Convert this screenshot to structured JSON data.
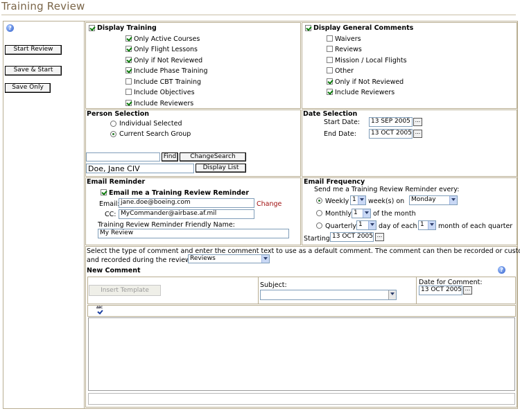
{
  "page": {
    "title": "Training Review"
  },
  "left": {
    "start_review": "Start Review",
    "save_start": "Save & Start",
    "save_only": "Save Only"
  },
  "display_training": {
    "label": "Display Training",
    "items": [
      {
        "label": "Only Active Courses",
        "checked": true
      },
      {
        "label": "Only Flight Lessons",
        "checked": true
      },
      {
        "label": "Only if Not Reviewed",
        "checked": true
      },
      {
        "label": "Include Phase Training",
        "checked": true
      },
      {
        "label": "Include CBT Training",
        "checked": false
      },
      {
        "label": "Include Objectives",
        "checked": false
      },
      {
        "label": "Include Reviewers",
        "checked": true
      }
    ]
  },
  "display_comments": {
    "label": "Display General Comments",
    "items": [
      {
        "label": "Waivers",
        "checked": false
      },
      {
        "label": "Reviews",
        "checked": false
      },
      {
        "label": "Mission / Local Flights",
        "checked": false
      },
      {
        "label": "Other",
        "checked": false
      },
      {
        "label": "Only if Not Reviewed",
        "checked": true
      },
      {
        "label": "Include Reviewers",
        "checked": true
      }
    ]
  },
  "person": {
    "title": "Person Selection",
    "individual": "Individual Selected",
    "current_group": "Current Search Group",
    "find": "Find",
    "change_search": "ChangeSearch",
    "selected_name": "Doe, Jane CIV",
    "display_list": "Display List"
  },
  "date_selection": {
    "title": "Date Selection",
    "start_label": "Start Date:",
    "start_value": "13 SEP 2005",
    "end_label": "End Date:",
    "end_value": "13 OCT 2005"
  },
  "email_reminder": {
    "title": "Email Reminder",
    "checkbox_label": "Email me a Training Review Reminder",
    "email_label": "Email:",
    "email_value": "jane.doe@boeing.com",
    "change": "Change",
    "cc_label": "CC:",
    "cc_value": "MyCommander@airbase.af.mil",
    "friendly_label": "Training Review Reminder Friendly Name:",
    "friendly_value": "My Review"
  },
  "email_frequency": {
    "title": "Email Frequency",
    "intro": "Send me a Training Review Reminder every:",
    "weekly": "Weekly",
    "weekly_count": "1",
    "weeks_on": "week(s) on",
    "weekday": "Monday",
    "monthly": "Monthly",
    "monthly_count": "1",
    "of_month": "of the month",
    "quarterly": "Quarterly",
    "quarterly_day": "1",
    "day_of_each": "day of each",
    "quarter_month": "1",
    "month_of_quarter": "month of each quarter",
    "starting_label": "Starting",
    "starting_value": "13 OCT 2005"
  },
  "comment": {
    "instructions_1": "Select the type of comment and enter the comment text to use as a default comment. The comment can then be recorded or customized",
    "instructions_2": "and recorded during the review.",
    "type_value": "Reviews",
    "new_comment": "New Comment",
    "insert_template": "Insert Template",
    "subject_label": "Subject:",
    "date_label": "Date for Comment:",
    "date_value": "13 OCT 2005",
    "spell_abbr": "ABC"
  }
}
